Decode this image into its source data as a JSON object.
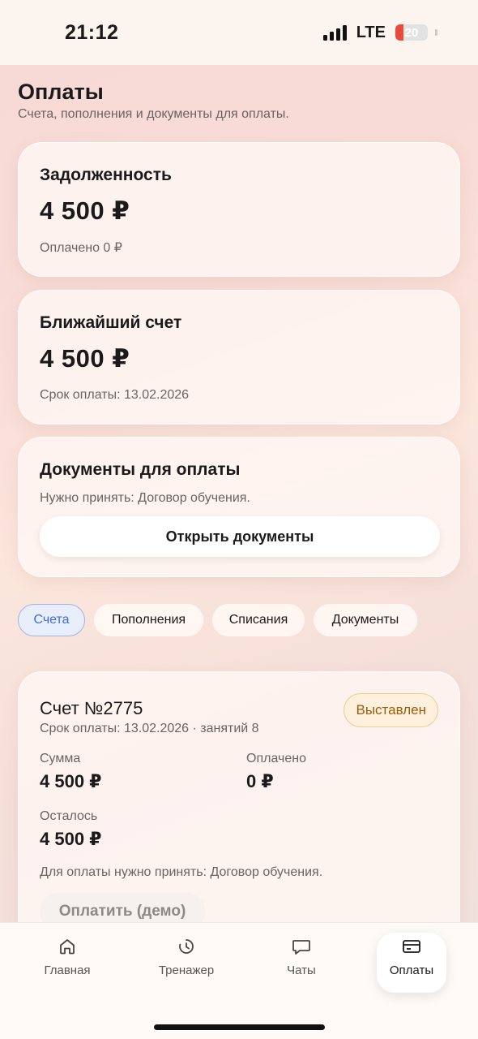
{
  "status_bar": {
    "time": "21:12",
    "network": "LTE",
    "battery": "20"
  },
  "page": {
    "title": "Оплаты",
    "subtitle": "Счета, пополнения и документы для оплаты."
  },
  "debt_card": {
    "title": "Задолженность",
    "amount": "4 500 ₽",
    "note": "Оплачено 0 ₽"
  },
  "next_bill_card": {
    "title": "Ближайший счет",
    "amount": "4 500 ₽",
    "note": "Срок оплаты: 13.02.2026"
  },
  "documents_card": {
    "title": "Документы для оплаты",
    "note": "Нужно принять: Договор обучения.",
    "button": "Открыть документы"
  },
  "tabs": [
    {
      "label": "Счета",
      "active": true
    },
    {
      "label": "Пополнения",
      "active": false
    },
    {
      "label": "Списания",
      "active": false
    },
    {
      "label": "Документы",
      "active": false
    }
  ],
  "invoice": {
    "title": "Счет №2775",
    "subtitle": "Срок оплаты: 13.02.2026 · занятий 8",
    "status": "Выставлен",
    "sum_label": "Сумма",
    "sum_value": "4 500 ₽",
    "paid_label": "Оплачено",
    "paid_value": "0 ₽",
    "left_label": "Осталось",
    "left_value": "4 500 ₽",
    "note": "Для оплаты нужно принять: Договор обучения.",
    "pay_button": "Оплатить (демо)"
  },
  "bottom_nav": [
    {
      "label": "Главная",
      "icon": "home-icon"
    },
    {
      "label": "Тренажер",
      "icon": "clock-icon"
    },
    {
      "label": "Чаты",
      "icon": "chat-icon"
    },
    {
      "label": "Оплаты",
      "icon": "card-icon",
      "active": true
    }
  ],
  "colors": {
    "accent_blue": "#3f6bd8",
    "status_badge": "#9a5b0e",
    "battery_low": "#e84a3d"
  }
}
